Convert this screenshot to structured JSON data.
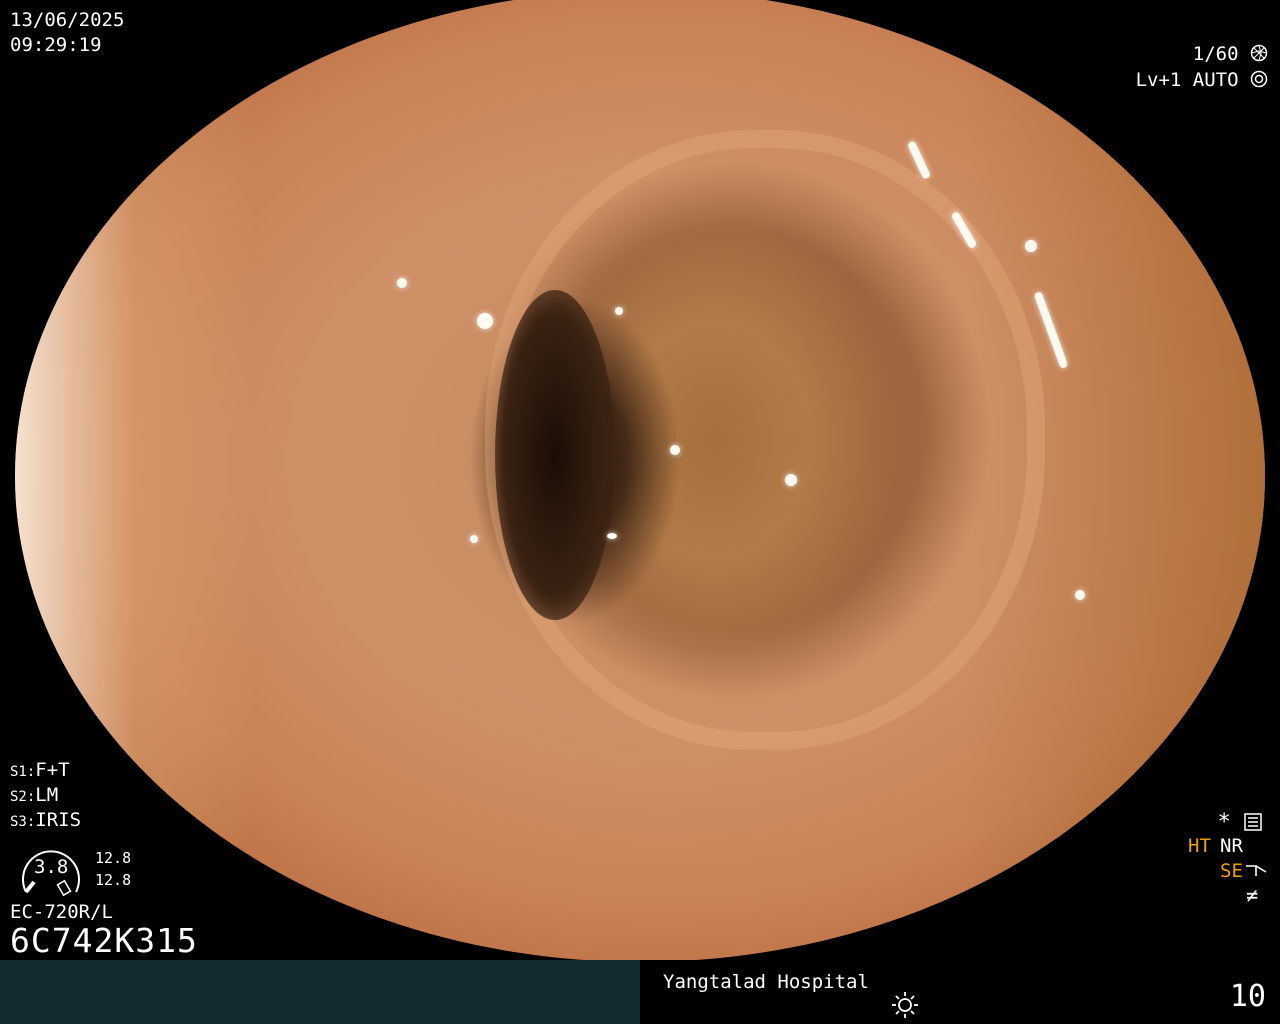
{
  "overlay": {
    "date": "13/06/2025",
    "time": "09:29:19",
    "shutter": "1/60",
    "shutter_icon": "shutter-icon",
    "level": "Lv+1 AUTO",
    "iris_icon": "iris-icon",
    "s1_label": "S1:",
    "s1_value": "F+T",
    "s2_label": "S2:",
    "s2_value": "LM",
    "s3_label": "S3:",
    "s3_value": "IRIS",
    "gauge_value": "3.8",
    "gauge_right_1": "12.8",
    "gauge_right_2": "12.8",
    "scope_model": "EC-720R/L",
    "serial": "6C742K315",
    "star": "*",
    "ht": "HT",
    "nr": "NR",
    "se": "SE",
    "filter_symbol": "≠",
    "hospital": "Yangtalad Hospital",
    "page_number": "10"
  },
  "colors": {
    "accent_orange": "#f0a000",
    "bottom_bar": "#132a2e"
  }
}
